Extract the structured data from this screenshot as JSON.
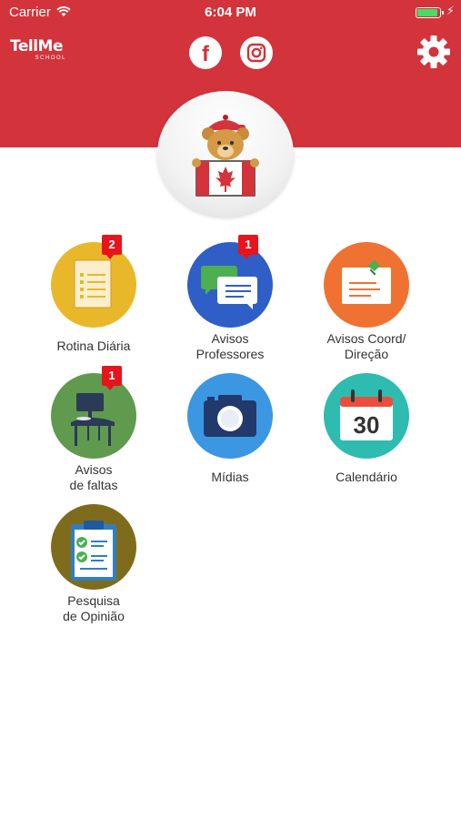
{
  "status_bar": {
    "carrier": "Carrier",
    "time": "6:04 PM"
  },
  "header": {
    "logo_text": "TellMe",
    "logo_sub": "SCHOOL",
    "facebook_label": "f",
    "background_color": "#d3333a"
  },
  "menu": {
    "items": [
      {
        "label": "Rotina Diária",
        "badge": "2",
        "color": "#e9b82a",
        "icon": "clipboard-list-icon"
      },
      {
        "label": "Avisos\nProfessores",
        "badge": "1",
        "color": "#2f5fc6",
        "icon": "chat-bubbles-icon"
      },
      {
        "label": "Avisos Coord/\nDireção",
        "badge": "",
        "color": "#ef7232",
        "icon": "pinned-note-icon"
      },
      {
        "label": "Avisos\nde faltas",
        "badge": "1",
        "color": "#5f9a4e",
        "icon": "empty-desk-icon"
      },
      {
        "label": "Mídias",
        "badge": "",
        "color": "#3b97e1",
        "icon": "camera-icon"
      },
      {
        "label": "Calendário",
        "badge": "",
        "color": "#2dbcaf",
        "icon": "calendar-icon",
        "calendar_day": "30"
      },
      {
        "label": "Pesquisa\nde Opinião",
        "badge": "",
        "color": "#7e6c1c",
        "icon": "survey-clipboard-icon"
      }
    ]
  }
}
